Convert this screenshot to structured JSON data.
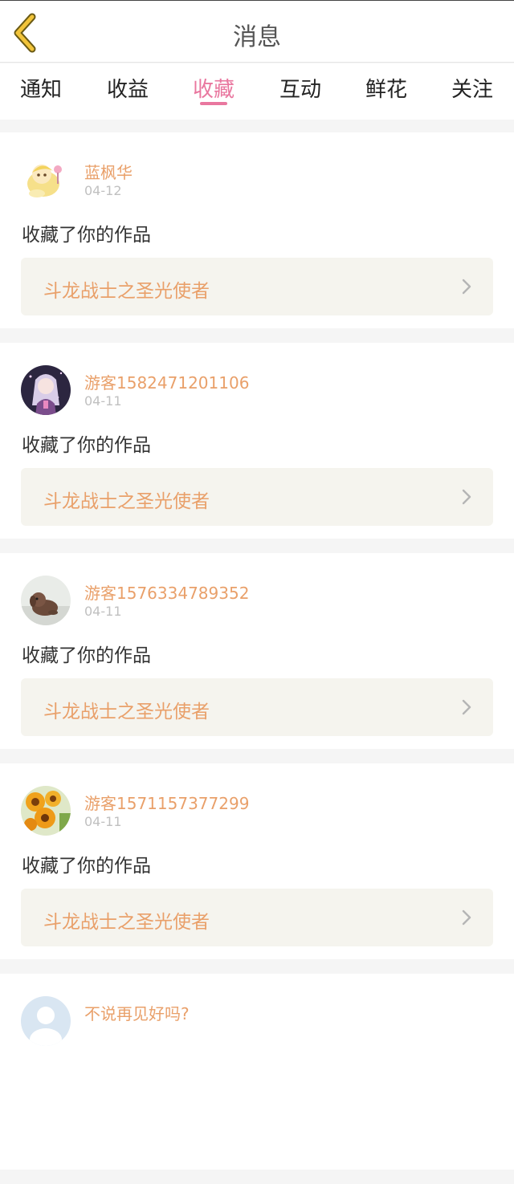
{
  "header": {
    "title": "消息"
  },
  "tabs": [
    {
      "label": "通知"
    },
    {
      "label": "收益"
    },
    {
      "label": "收藏"
    },
    {
      "label": "互动"
    },
    {
      "label": "鲜花"
    },
    {
      "label": "关注"
    }
  ],
  "active_tab": "收藏",
  "colors": {
    "accent": "#e9779f",
    "name": "#e9a06a",
    "work_bg": "#f5f4ee"
  },
  "messages": [
    {
      "user": "蓝枫华",
      "date": "04-12",
      "action": "收藏了你的作品",
      "work": "斗龙战士之圣光使者",
      "avatar_icon": "cartoon-girl-avatar-icon"
    },
    {
      "user": "游客1582471201106",
      "date": "04-11",
      "action": "收藏了你的作品",
      "work": "斗龙战士之圣光使者",
      "avatar_icon": "anime-girl-avatar-icon"
    },
    {
      "user": "游客1576334789352",
      "date": "04-11",
      "action": "收藏了你的作品",
      "work": "斗龙战士之圣光使者",
      "avatar_icon": "puppy-avatar-icon"
    },
    {
      "user": "游客1571157377299",
      "date": "04-11",
      "action": "收藏了你的作品",
      "work": "斗龙战士之圣光使者",
      "avatar_icon": "sunflower-avatar-icon"
    },
    {
      "user": "不说再见好吗?",
      "avatar_icon": "default-avatar-icon"
    }
  ]
}
